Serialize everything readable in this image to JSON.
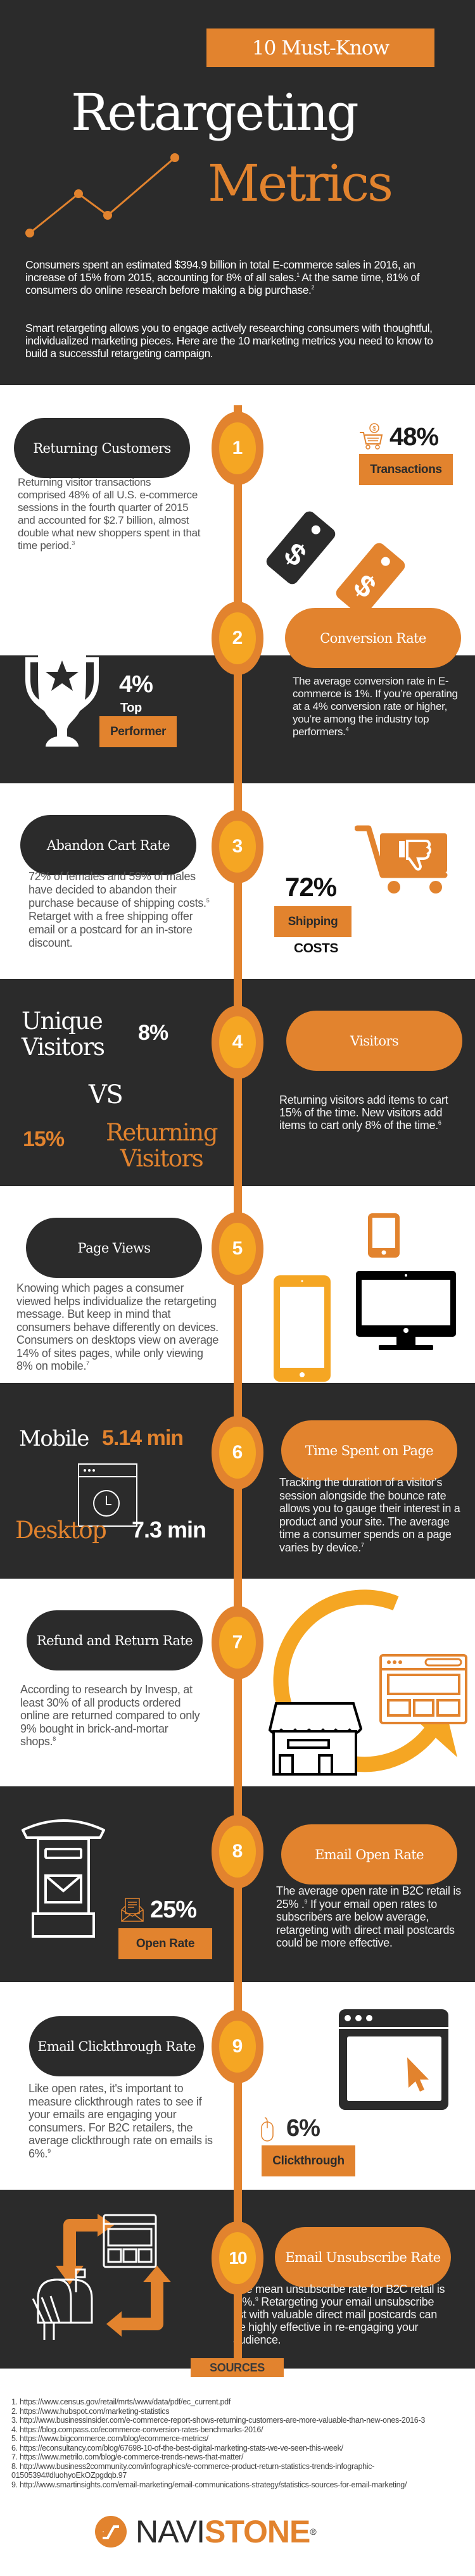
{
  "header": {
    "badge": "10 Must-Know",
    "title_line1": "Retargeting",
    "title_line2": "Metrics",
    "intro_p1": "Consumers spent an estimated $394.9 billion in total E-commerce sales in 2016, an increase of 15% from 2015, accounting for 8% of all sales.",
    "intro_p1_ref": "1",
    "intro_p1b": " At the same time, 81% of consumers do online research before making a big purchase.",
    "intro_p1b_ref": "2",
    "intro_p2": "Smart retargeting allows you to engage actively researching consumers with thoughtful, individualized marketing pieces. Here are the 10 marketing metrics you need to know to build a successful retargeting campaign."
  },
  "colors": {
    "dark": "#2b2b2b",
    "orange": "#e2832e",
    "amber": "#f5a623",
    "white": "#ffffff"
  },
  "metrics": [
    {
      "number": "1",
      "title": "Returning Customers",
      "body": "Returning visitor transactions comprised 48% of all U.S. e-commerce sessions in the fourth quarter of 2015 and accounted for $2.7 billion, almost double what new shoppers spent in that time period.",
      "ref": "3",
      "stat": "48%",
      "tag": "Transactions"
    },
    {
      "number": "2",
      "title": "Conversion Rate",
      "body": "The average conversion rate in E-commerce is 1%. If you’re operating at a 4% conversion rate or higher, you’re among the industry top performers.",
      "ref": "4",
      "stat": "4%",
      "stat_label": "Top",
      "tag": "Performer"
    },
    {
      "number": "3",
      "title": "Abandon Cart Rate",
      "body_a": "72% of females and 59% of males have decided to abandon their purchase because of shipping costs.",
      "ref": "5",
      "body_b": " Retarget with a free shipping offer email or a postcard for an in-store discount.",
      "stat": "72%",
      "tag": "Shipping",
      "stat_label": "COSTS"
    },
    {
      "number": "4",
      "title": "Visitors",
      "body": "Returning visitors add items to cart 15% of the time. New visitors add items to cart only 8% of the time.",
      "ref": "6",
      "unique_label": "Unique Visitors",
      "unique_stat": "8%",
      "vs": "VS",
      "returning_label": "Returning Visitors",
      "returning_stat": "15%"
    },
    {
      "number": "5",
      "title": "Page Views",
      "body": "Knowing which pages a consumer viewed helps individualize the retargeting message. But keep in mind that consumers behave differently on devices. Consumers on desktops view on average 14% of sites pages, while only viewing 8% on mobile.",
      "ref": "7"
    },
    {
      "number": "6",
      "title": "Time Spent on Page",
      "body": "Tracking the duration of a visitor's session alongside the bounce rate allows you to gauge their interest in a product and your site. The average time a consumer spends on a page varies by device.",
      "ref": "7",
      "mobile_label": "Mobile",
      "mobile_stat": "5.14 min",
      "desktop_label": "Desktop",
      "desktop_stat": "7.3 min"
    },
    {
      "number": "7",
      "title": "Refund and Return Rate",
      "body": "According to research by Invesp, at least 30% of all products ordered online are returned compared to only 9% bought in brick-and-mortar shops.",
      "ref": "8"
    },
    {
      "number": "8",
      "title": "Email Open Rate",
      "body_a": "The average open rate in B2C retail is 25% .",
      "ref": "9",
      "body_b": " If your email open rates to subscribers are below average, retargeting with direct mail postcards could be more effective.",
      "stat": "25%",
      "tag": "Open Rate"
    },
    {
      "number": "9",
      "title": "Email Clickthrough Rate",
      "body": "Like open rates, it's important to measure clickthrough rates to see if your emails are engaging your consumers. For B2C retailers, the average clickthrough rate on emails is 6%.",
      "ref": "9",
      "stat": "6%",
      "tag": "Clickthrough"
    },
    {
      "number": "10",
      "title": "Email Unsubscribe Rate",
      "body_a": "The mean unsubscribe rate for B2C retail is .6%.",
      "ref": "9",
      "body_b": " Retargeting your email unsubscribe list with valuable direct mail postcards can be highly effective in re-engaging your audience."
    }
  ],
  "sources": {
    "heading": "SOURCES",
    "items": [
      "1. https://www.census.gov/retail/mrts/www/data/pdf/ec_current.pdf",
      "2. https://www.hubspot.com/marketing-statistics",
      "3. http://www.businessinsider.com/e-commerce-report-shows-returning-customers-are-more-valuable-than-new-ones-2016-3",
      "4. https://blog.compass.co/ecommerce-conversion-rates-benchmarks-2016/",
      "5. https://www.bigcommerce.com/blog/ecommerce-metrics/",
      "6. https://econsultancy.com/blog/67698-10-of-the-best-digital-marketing-stats-we-ve-seen-this-week/",
      "7. https://www.metrilo.com/blog/e-commerce-trends-news-that-matter/",
      "8. http://www.business2community.com/infographics/e-commerce-product-return-statistics-trends-infographic-01505394#dluohyoEkOZpgdqb.97",
      "9. http://www.smartinsights.com/email-marketing/email-communications-strategy/statistics-sources-for-email-marketing/"
    ]
  },
  "brand": {
    "name_part1": "NAVI",
    "name_part2": "STONE",
    "registered": "®"
  }
}
